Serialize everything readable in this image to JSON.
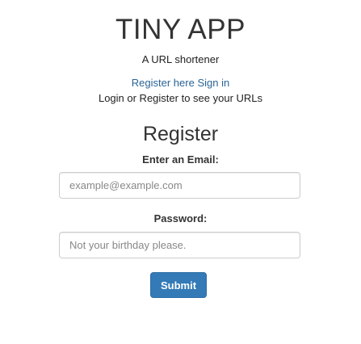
{
  "header": {
    "app_title": "TINY APP",
    "tagline": "A URL shortener",
    "register_link": "Register here",
    "signin_link": "Sign in",
    "login_message": "Login or Register to see your URLs"
  },
  "form": {
    "title": "Register",
    "email_label": "Enter an Email:",
    "email_placeholder": "example@example.com",
    "email_value": "",
    "password_label": "Password:",
    "password_placeholder": "Not your birthday please.",
    "password_value": "",
    "submit_label": "Submit"
  },
  "colors": {
    "link": "#2a6496",
    "primary_button": "#337ab7",
    "text": "#333333"
  }
}
